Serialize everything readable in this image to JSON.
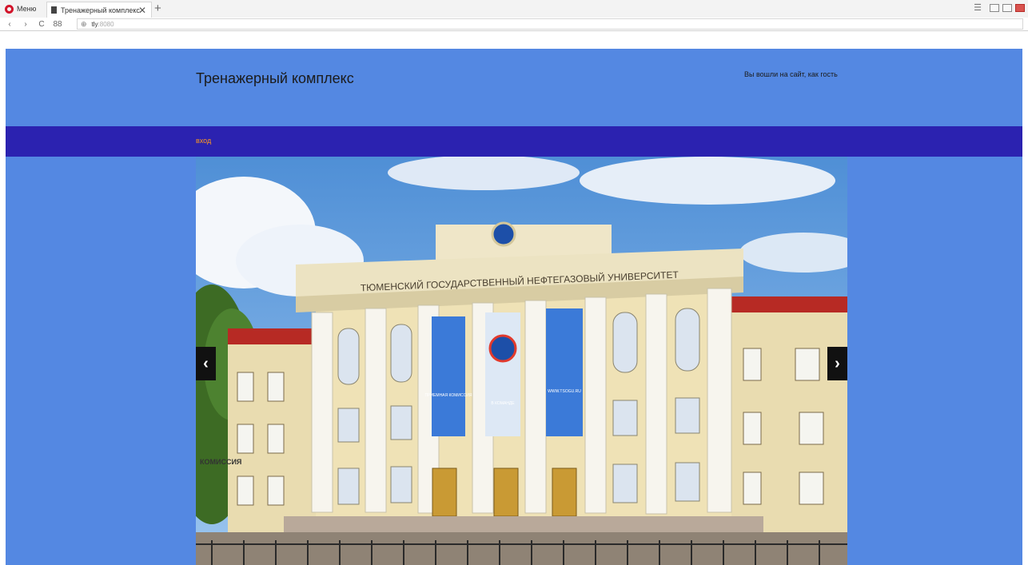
{
  "browser": {
    "menu_label": "Меню",
    "tab_title": "Тренажерный комплекс",
    "close_tab": "✕",
    "new_tab": "+",
    "url_host": "tly",
    "url_port": ":8080",
    "nav": {
      "back": "‹",
      "forward": "›",
      "reload": "C",
      "speed_dial": "88",
      "globe": "⊕"
    }
  },
  "header": {
    "title": "Тренажерный комплекс",
    "guest_status": "Вы вошли на сайт, как гость"
  },
  "nav": {
    "login": "вход"
  },
  "slider": {
    "prev": "‹",
    "next": "›",
    "building_sign": "ТЮМЕНСКИЙ ГОСУДАРСТВЕННЫЙ НЕФТЕГАЗОВЫЙ УНИВЕРСИТЕТ",
    "banner_left": "ПРИЕМНАЯ КОМИССИЯ",
    "banner_middle": "В КОМАНДЕ",
    "banner_right": "WWW.TSOGU.RU",
    "side_sign": "КОМИССИЯ"
  },
  "colors": {
    "page_bg": "#5488e2",
    "nav_bg": "#2b22b0",
    "nav_link": "#ff9a1e"
  }
}
